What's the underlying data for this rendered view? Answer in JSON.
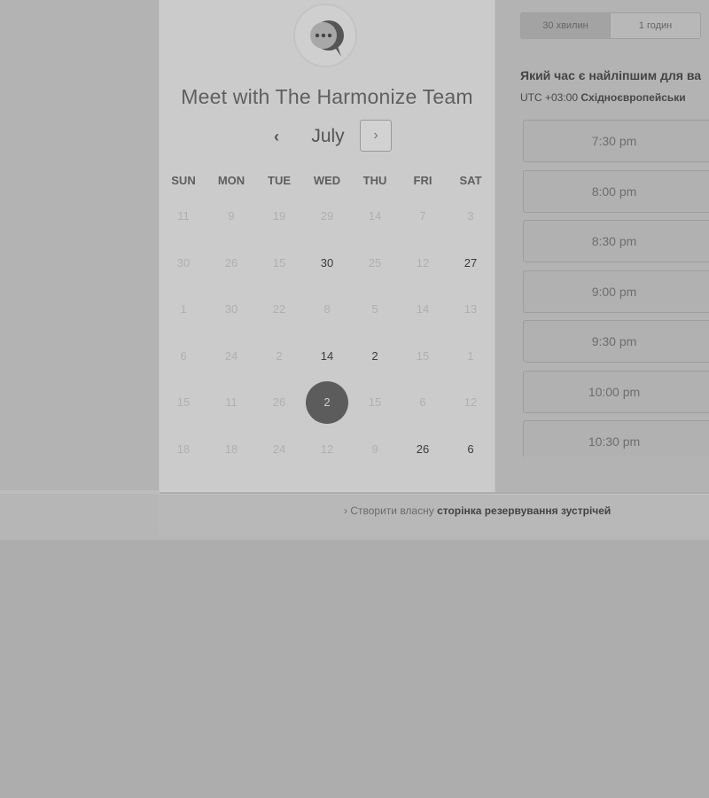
{
  "header": {
    "title": "Meet with The Harmonize Team",
    "month": "July",
    "prev_icon": "chevron-left-icon",
    "next_icon": "chevron-right-icon",
    "logo_icon": "chat-bubble-icon"
  },
  "weekdays": [
    "SUN",
    "MON",
    "TUE",
    "WED",
    "THU",
    "FRI",
    "SAT"
  ],
  "calendar": {
    "weeks": [
      [
        {
          "d": "11"
        },
        {
          "d": "9"
        },
        {
          "d": "19"
        },
        {
          "d": "29"
        },
        {
          "d": "14"
        },
        {
          "d": "7"
        },
        {
          "d": "3"
        }
      ],
      [
        {
          "d": "30"
        },
        {
          "d": "26"
        },
        {
          "d": "15"
        },
        {
          "d": "30",
          "a": true
        },
        {
          "d": "25"
        },
        {
          "d": "12"
        },
        {
          "d": "27",
          "a": true
        }
      ],
      [
        {
          "d": "1"
        },
        {
          "d": "30"
        },
        {
          "d": "22"
        },
        {
          "d": "8"
        },
        {
          "d": "5"
        },
        {
          "d": "14"
        },
        {
          "d": "13"
        }
      ],
      [
        {
          "d": "6"
        },
        {
          "d": "24"
        },
        {
          "d": "2"
        },
        {
          "d": "14",
          "a": true
        },
        {
          "d": "2",
          "a": true
        },
        {
          "d": "15"
        },
        {
          "d": "1"
        }
      ],
      [
        {
          "d": "15"
        },
        {
          "d": "11"
        },
        {
          "d": "26"
        },
        {
          "d": "2",
          "a": true,
          "s": true
        },
        {
          "d": "15"
        },
        {
          "d": "6"
        },
        {
          "d": "12"
        }
      ],
      [
        {
          "d": "18"
        },
        {
          "d": "18"
        },
        {
          "d": "24"
        },
        {
          "d": "12"
        },
        {
          "d": "9"
        },
        {
          "d": "26",
          "a": true
        },
        {
          "d": "6",
          "a": true
        }
      ]
    ]
  },
  "durations": {
    "option_30": "30 хвилин",
    "option_60": "1 годин"
  },
  "times": {
    "question": "Який час є найліпшим для ва",
    "tz_offset": "UTC +03:00",
    "tz_name": "Східноєвропейськи",
    "slots": [
      "7:30 pm",
      "8:00 pm",
      "8:30 pm",
      "9:00 pm",
      "9:30 pm",
      "10:00 pm",
      "10:30 pm"
    ]
  },
  "footer": {
    "prefix": "Створити власну",
    "link": "сторінка резервування зустрічей"
  },
  "colors": {
    "background": "#adadad",
    "card": "#cbcbcb",
    "selected_day": "#5c5c5c"
  }
}
